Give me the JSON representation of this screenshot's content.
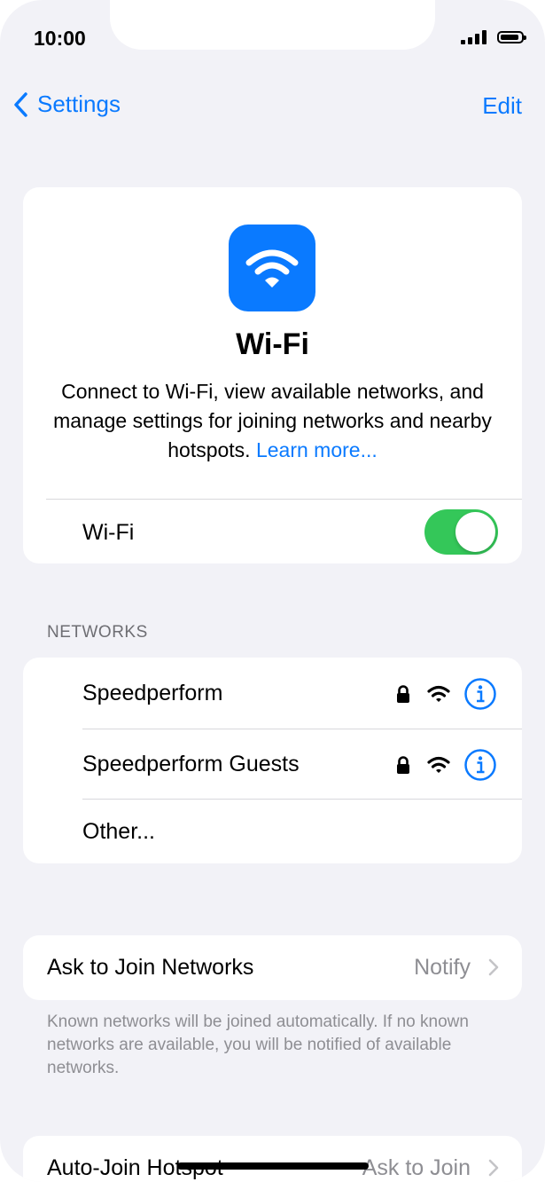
{
  "status_bar": {
    "time": "10:00"
  },
  "nav": {
    "back_label": "Settings",
    "edit_label": "Edit"
  },
  "hero": {
    "title": "Wi-Fi",
    "description": "Connect to Wi-Fi, view available networks, and manage settings for joining networks and nearby hotspots.",
    "link": "Learn more..."
  },
  "wifi_toggle": {
    "label": "Wi-Fi",
    "on": true
  },
  "networks": {
    "header": "NETWORKS",
    "items": [
      {
        "name": "Speedperform",
        "secured": true
      },
      {
        "name": "Speedperform Guests",
        "secured": true
      }
    ],
    "other_label": "Other..."
  },
  "ask_to_join": {
    "label": "Ask to Join Networks",
    "value": "Notify",
    "footnote": "Known networks will be joined automatically. If no known networks are available, you will be notified of available networks."
  },
  "auto_join": {
    "label": "Auto-Join Hotspot",
    "value": "Ask to Join"
  },
  "colors": {
    "accent": "#0a7aff",
    "toggle_on": "#34c759",
    "background": "#f2f2f7"
  }
}
